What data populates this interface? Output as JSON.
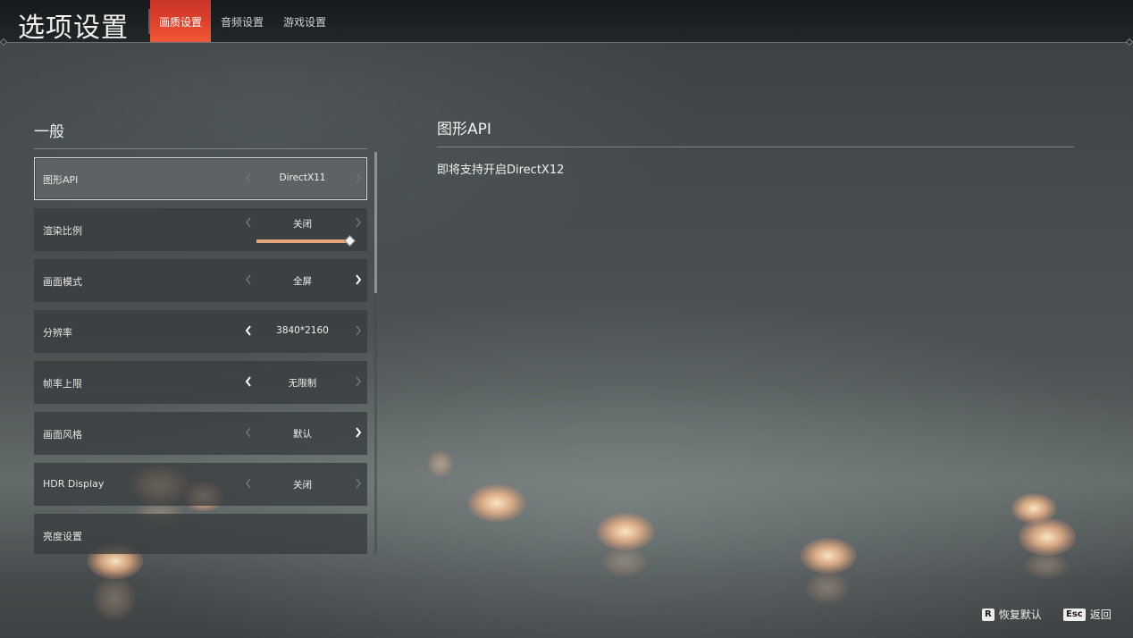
{
  "header": {
    "title": "选项设置",
    "tabs": [
      {
        "label": "画质设置",
        "active": true
      },
      {
        "label": "音频设置",
        "active": false
      },
      {
        "label": "游戏设置",
        "active": false
      }
    ]
  },
  "left_panel": {
    "section_title": "一般",
    "rows": [
      {
        "label": "图形API",
        "value": "DirectX11",
        "selected": true,
        "left_arrow": "dim",
        "right_arrow": "dim"
      },
      {
        "label": "渲染比例",
        "value": "关闭",
        "selected": false,
        "left_arrow": "dim",
        "right_arrow": "dim",
        "slider_level": 1.0
      },
      {
        "label": "画面模式",
        "value": "全屏",
        "selected": false,
        "left_arrow": "dim",
        "right_arrow": "bright"
      },
      {
        "label": "分辨率",
        "value": "3840*2160",
        "selected": false,
        "left_arrow": "bright",
        "right_arrow": "dim"
      },
      {
        "label": "帧率上限",
        "value": "无限制",
        "selected": false,
        "left_arrow": "bright",
        "right_arrow": "dim"
      },
      {
        "label": "画面风格",
        "value": "默认",
        "selected": false,
        "left_arrow": "dim",
        "right_arrow": "bright"
      },
      {
        "label": "HDR Display",
        "value": "关闭",
        "selected": false,
        "left_arrow": "dim",
        "right_arrow": "dim"
      },
      {
        "label": "亮度设置",
        "value": "",
        "selected": false,
        "left_arrow": "none",
        "right_arrow": "none"
      }
    ]
  },
  "right_panel": {
    "title": "图形API",
    "description": "即将支持开启DirectX12"
  },
  "footer": {
    "reset": {
      "key": "R",
      "label": "恢复默认"
    },
    "back": {
      "key": "Esc",
      "label": "返回"
    }
  },
  "colors": {
    "tab_active": "#e3452d",
    "slider": "#e6a67c",
    "arrow_bright": "#ffffff",
    "arrow_dim": "#6e7376"
  }
}
